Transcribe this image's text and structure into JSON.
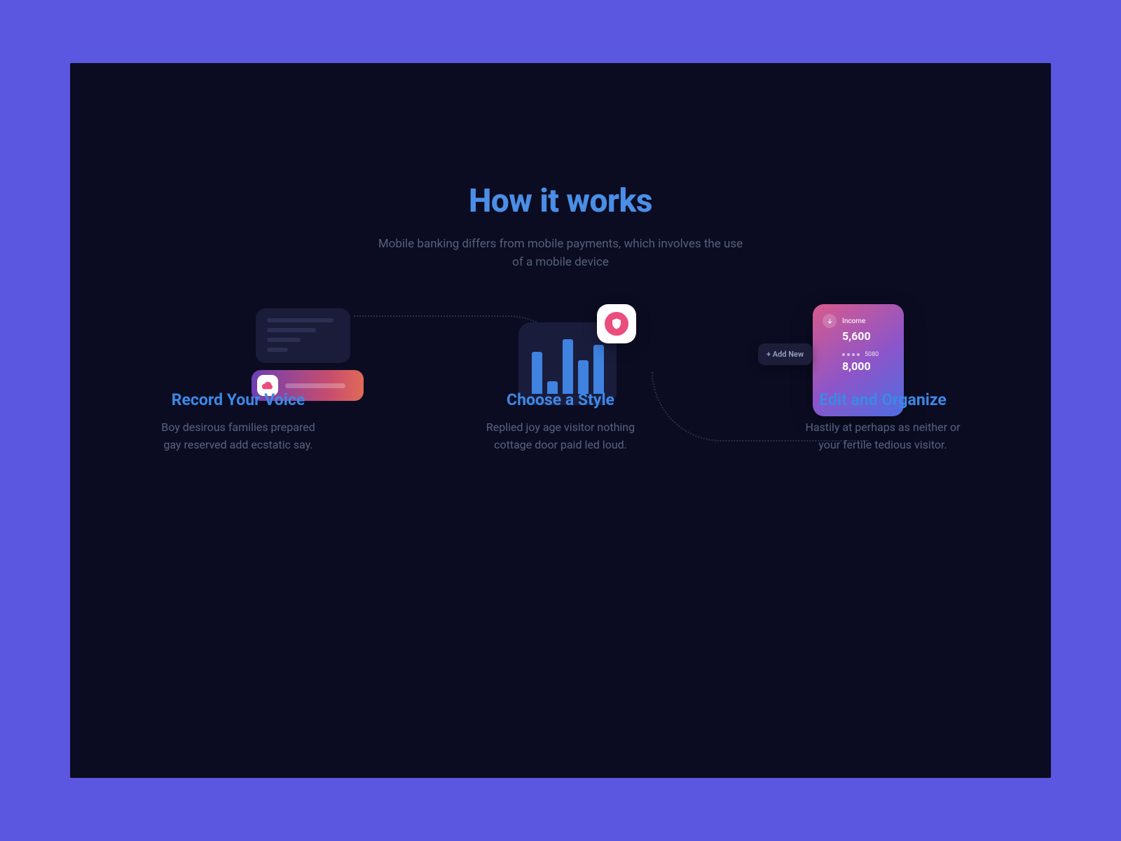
{
  "header": {
    "title": "How it works",
    "subtitle": "Mobile banking differs from mobile payments, which involves the use of a mobile device"
  },
  "steps": [
    {
      "title": "Record Your Voice",
      "desc": "Boy desirous families prepared gay reserved add ecstatic say."
    },
    {
      "title": "Choose a Style",
      "desc": "Replied joy age visitor nothing cottage door paid led loud."
    },
    {
      "title": "Edit and Organize",
      "desc": "Hastily at perhaps as neither or your fertile tedious visitor."
    }
  ],
  "card": {
    "income_label": "Income",
    "income_value": "5,600",
    "masked_value": "5080",
    "big_value": "8,000",
    "chip_label": "+ Add New"
  }
}
